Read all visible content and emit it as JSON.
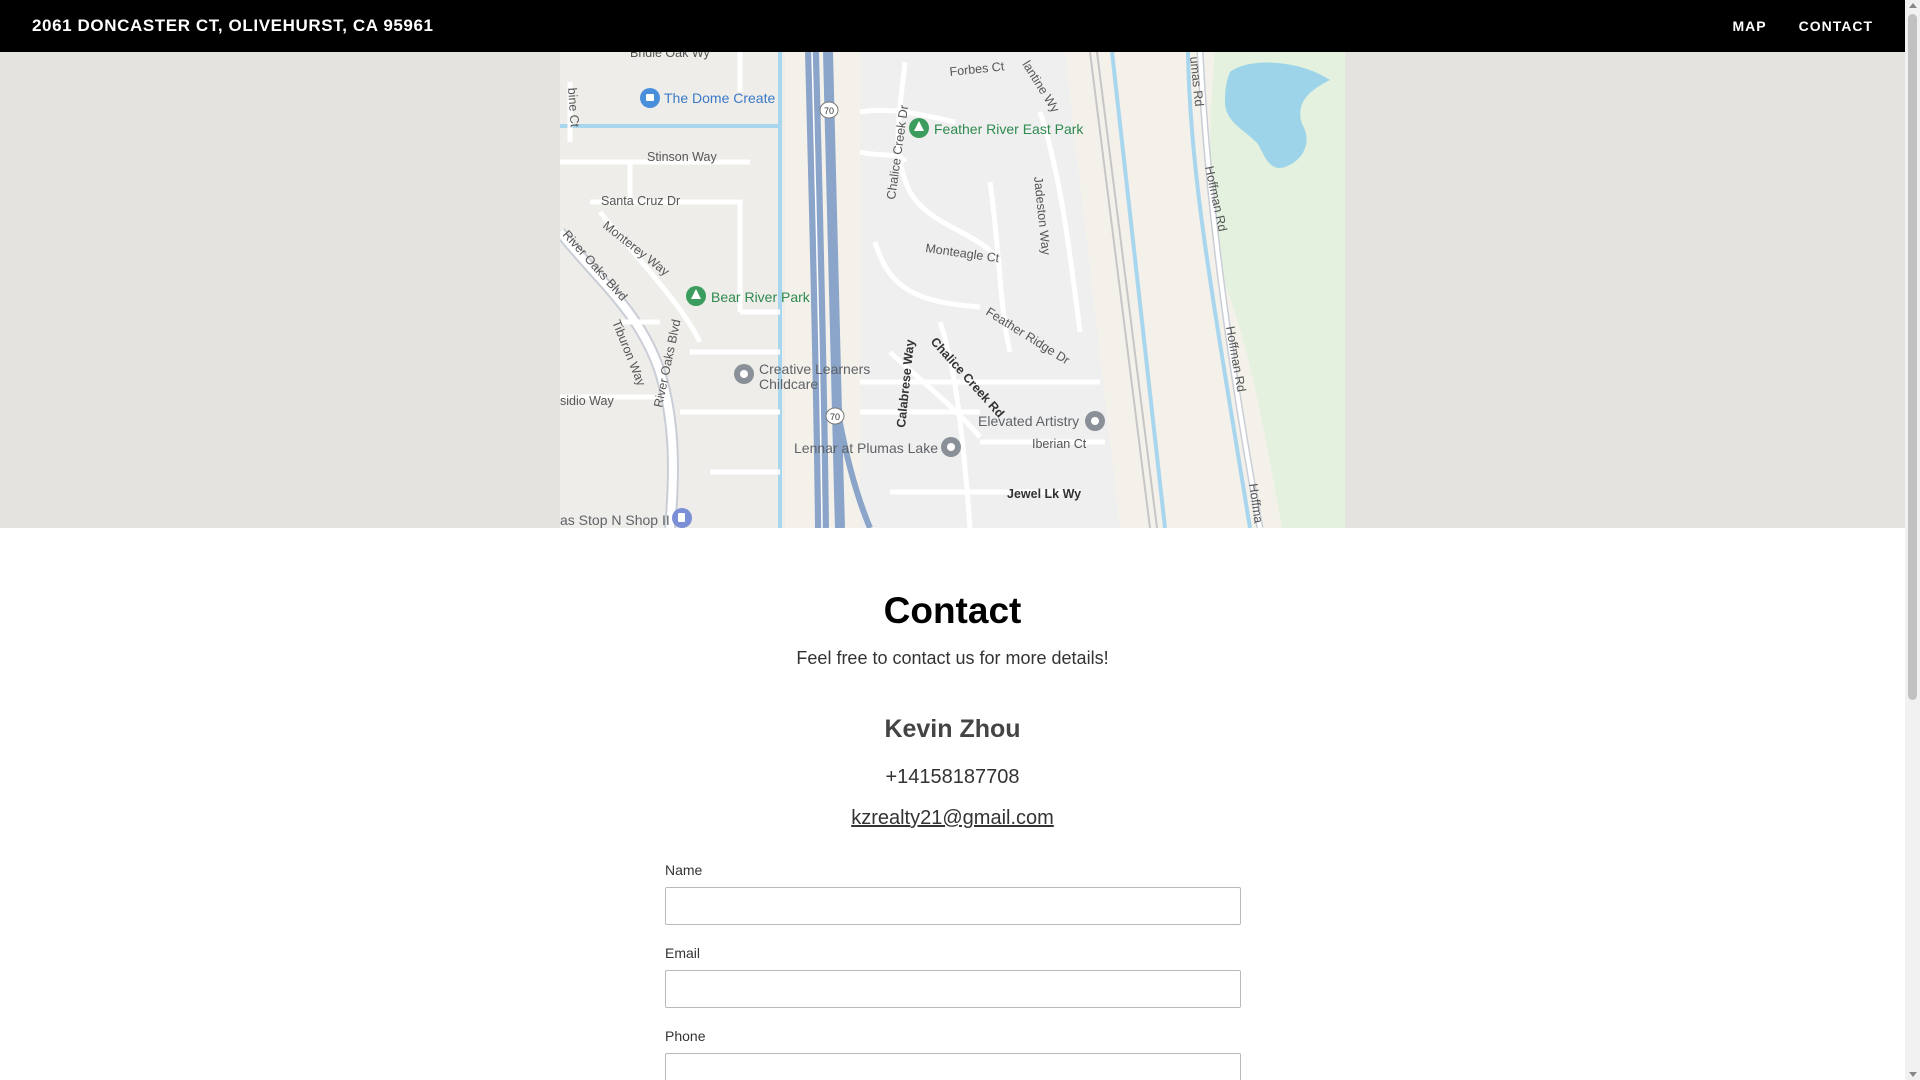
{
  "header": {
    "title": "2061 DONCASTER CT, OLIVEHURST, CA 95961",
    "nav": [
      {
        "label": "MAP"
      },
      {
        "label": "CONTACT"
      }
    ]
  },
  "map": {
    "places": {
      "dome_create": "The Dome Create",
      "feather_river_east_park": "Feather River East Park",
      "bear_river_park": "Bear River Park",
      "creative_learners_1": "Creative Learners",
      "creative_learners_2": "Childcare",
      "elevated_artistry": "Elevated Artistry",
      "lennar": "Lennar at Plumas Lake",
      "gas_stop": "as Stop N Shop II"
    },
    "streets": {
      "bridle_oak": "Bridle Oak Wy",
      "forbes": "Forbes Ct",
      "lantine": "lantine Wy",
      "plumas_rd": "umas Rd",
      "stinson": "Stinson Way",
      "santa_cruz": "Santa Cruz Dr",
      "monterey": "Monterey Way",
      "river_oaks_1": "River Oaks Blvd",
      "river_oaks_2": "River Oaks Blvd",
      "tiburon": "Tiburon Way",
      "presidio": "sidio Way",
      "chalice_creek_dr": "Chalice Creek Dr",
      "monteagle": "Monteagle Ct",
      "jadeston": "Jadeston Way",
      "feather_ridge": "Feather Ridge Dr",
      "chalice_creek_rd": "Chalice Creek Rd",
      "calabrese": "Calabrese Way",
      "iberian": "Iberian Ct",
      "jewel_lk": "Jewel Lk Wy",
      "hoffman_1": "Hoffman Rd",
      "hoffman_2": "Hoffman Rd",
      "hoffman_3": "Hoffma",
      "bine": "bine Ct",
      "hwy_1": "70",
      "hwy_2": "70"
    }
  },
  "contact": {
    "heading": "Contact",
    "subtitle": "Feel free to contact us for more details!",
    "agent_name": "Kevin Zhou",
    "phone": "+14158187708",
    "email": "kzrealty21@gmail.com"
  },
  "form": {
    "name_label": "Name",
    "email_label": "Email",
    "phone_label": "Phone"
  }
}
